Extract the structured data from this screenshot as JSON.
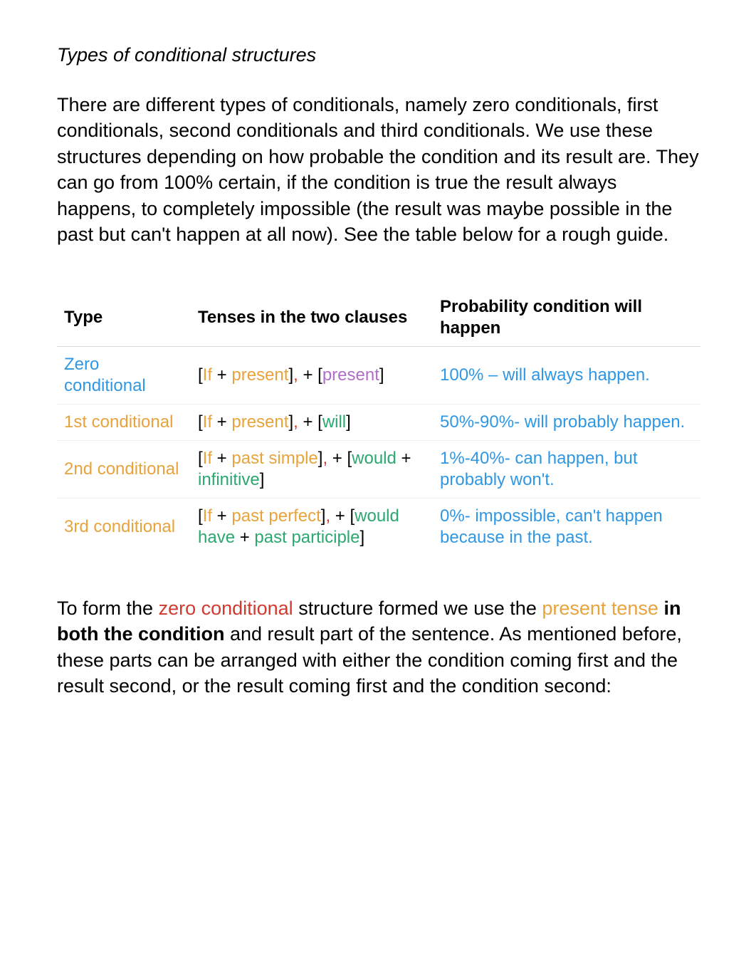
{
  "heading": "Types of conditional structures",
  "intro": "There are different types of conditionals, namely zero conditionals, first conditionals, second conditionals and third conditionals. We use these structures depending on how probable the condition and its result are. They can go from 100% certain, if the condition is true the result always happens, to completely impossible (the result was maybe possible in the past but can't happen at all now). See the table below for a rough guide.",
  "table": {
    "headers": {
      "type": "Type",
      "tenses": "Tenses in the two clauses",
      "prob": "Probability condition will happen"
    },
    "rows": [
      {
        "type": "Zero conditional",
        "tenses_parts": {
          "t0": "[",
          "t1": "If",
          "t2": " + ",
          "t3": "present",
          "t4": "]",
          "t5": ", ",
          "t6": "+ [",
          "t7": "present",
          "t8": "]"
        },
        "prob": "100% – will always happen."
      },
      {
        "type": "1st conditional",
        "tenses_parts": {
          "t0": "[",
          "t1": "If",
          "t2": " + ",
          "t3": "present",
          "t4": "]",
          "t5": ", ",
          "t6": "+ [",
          "t7": "will",
          "t8": "]"
        },
        "prob": "50%-90%- will probably happen."
      },
      {
        "type": "2nd conditional",
        "tenses_parts": {
          "t0": "[",
          "t1": "If",
          "t2": " + ",
          "t3": "past simple",
          "t4": "]",
          "t5": ", ",
          "t6": "+ [",
          "t7a": "would",
          "t7b": " + ",
          "t7c": "infinitive",
          "t8": "]"
        },
        "prob": "1%-40%- can happen, but probably won't."
      },
      {
        "type": "3rd conditional",
        "tenses_parts": {
          "t0": "[",
          "t1": "If",
          "t2": " + ",
          "t3": "past perfect",
          "t4": "]",
          "t5": ", ",
          "t6": "+ [",
          "t7a": "would have",
          "t7b": " + ",
          "t7c": "past participle",
          "t8": "]"
        },
        "prob": "0%- impossible, can't happen because in the past."
      }
    ]
  },
  "outro": {
    "p0": "To form the ",
    "p1": "zero conditional",
    "p2": " structure formed we use the ",
    "p3": "present tense",
    "p4": " in both the condition",
    "p5": " and result part of the sentence. As mentioned before, these parts can be arranged with either the condition coming first and the result second, or the result coming first and the condition second:"
  },
  "chart_data": {
    "type": "table",
    "title": "Types of conditional structures",
    "columns": [
      "Type",
      "Tenses in the two clauses",
      "Probability condition will happen"
    ],
    "rows": [
      [
        "Zero conditional",
        "[If + present], + [present]",
        "100% – will always happen."
      ],
      [
        "1st conditional",
        "[If + present], + [will]",
        "50%-90%- will probably happen."
      ],
      [
        "2nd conditional",
        "[If + past simple], + [would + infinitive]",
        "1%-40%- can happen, but probably won't."
      ],
      [
        "3rd conditional",
        "[If + past perfect], + [would have + past participle]",
        "0%- impossible, can't happen because in the past."
      ]
    ]
  }
}
